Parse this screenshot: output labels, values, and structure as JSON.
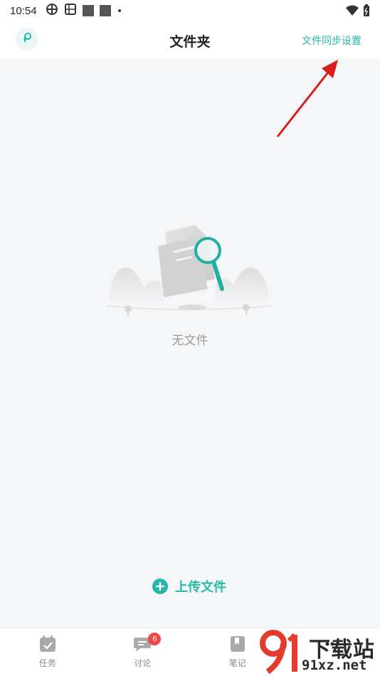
{
  "status_bar": {
    "time": "10:54"
  },
  "header": {
    "title": "文件夹",
    "action_label": "文件同步设置"
  },
  "empty_state": {
    "message": "无文件"
  },
  "upload": {
    "label": "上传文件"
  },
  "bottom_nav": {
    "items": [
      {
        "label": "任务",
        "icon": "calendar-check-icon"
      },
      {
        "label": "讨论",
        "icon": "chat-bubble-icon",
        "badge": "6"
      },
      {
        "label": "笔记",
        "icon": "bookmark-icon"
      },
      {
        "label": "",
        "icon": "more-icon"
      }
    ]
  },
  "watermark": {
    "top_text": "下载站",
    "bottom_text": "91xz.net"
  },
  "colors": {
    "accent": "#23b9a8",
    "badge": "#f0484a",
    "annotation_arrow": "#d81e1e",
    "background": "#f5f6f8"
  }
}
